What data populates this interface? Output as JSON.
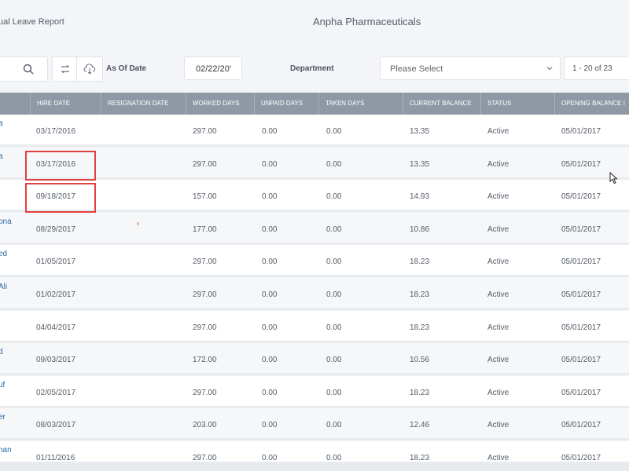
{
  "header": {
    "report_title": "ual Leave Report",
    "company": "Anpha Pharmaceuticals"
  },
  "toolbar": {
    "as_of_label": "As Of Date",
    "date_value": "02/22/20'",
    "department_label": "Department",
    "department_placeholder": "Please Select",
    "pager_text": "1 - 20 of 23"
  },
  "columns": [
    "Hire Date",
    "Resignation Date",
    "Worked Days",
    "Unpaid Days",
    "Taken Days",
    "Current Balance",
    "Status",
    "Opening Balance I"
  ],
  "rows": [
    {
      "name": "a",
      "hire": "03/17/2016",
      "resign": "",
      "worked": "297.00",
      "unpaid": "0.00",
      "taken": "0.00",
      "balance": "13.35",
      "status": "Active",
      "opening": "05/01/2017"
    },
    {
      "name": "a",
      "hire": "03/17/2016",
      "resign": "",
      "worked": "297.00",
      "unpaid": "0.00",
      "taken": "0.00",
      "balance": "13.35",
      "status": "Active",
      "opening": "05/01/2017"
    },
    {
      "name": "",
      "hire": "09/18/2017",
      "resign": "",
      "worked": "157.00",
      "unpaid": "0.00",
      "taken": "0.00",
      "balance": "14.93",
      "status": "Active",
      "opening": "05/01/2017"
    },
    {
      "name": "ona",
      "hire": "08/29/2017",
      "resign": "",
      "worked": "177.00",
      "unpaid": "0.00",
      "taken": "0.00",
      "balance": "10.86",
      "status": "Active",
      "opening": "05/01/2017"
    },
    {
      "name": "ed",
      "hire": "01/05/2017",
      "resign": "",
      "worked": "297.00",
      "unpaid": "0.00",
      "taken": "0.00",
      "balance": "18.23",
      "status": "Active",
      "opening": "05/01/2017"
    },
    {
      "name": "Ali",
      "hire": "01/02/2017",
      "resign": "",
      "worked": "297.00",
      "unpaid": "0.00",
      "taken": "0.00",
      "balance": "18.23",
      "status": "Active",
      "opening": "05/01/2017"
    },
    {
      "name": "",
      "hire": "04/04/2017",
      "resign": "",
      "worked": "297.00",
      "unpaid": "0.00",
      "taken": "0.00",
      "balance": "18.23",
      "status": "Active",
      "opening": "05/01/2017"
    },
    {
      "name": "d",
      "hire": "09/03/2017",
      "resign": "",
      "worked": "172.00",
      "unpaid": "0.00",
      "taken": "0.00",
      "balance": "10.56",
      "status": "Active",
      "opening": "05/01/2017"
    },
    {
      "name": "uf",
      "hire": "02/05/2017",
      "resign": "",
      "worked": "297.00",
      "unpaid": "0.00",
      "taken": "0.00",
      "balance": "18.23",
      "status": "Active",
      "opening": "05/01/2017"
    },
    {
      "name": "er",
      "hire": "08/03/2017",
      "resign": "",
      "worked": "203.00",
      "unpaid": "0.00",
      "taken": "0.00",
      "balance": "12.46",
      "status": "Active",
      "opening": "05/01/2017"
    },
    {
      "name": "nan",
      "hire": "01/11/2016",
      "resign": "",
      "worked": "297.00",
      "unpaid": "0.00",
      "taken": "0.00",
      "balance": "18.23",
      "status": "Active",
      "opening": "05/01/2017"
    }
  ],
  "colors": {
    "header_bg": "#8f99a5",
    "link": "#2b6aa3",
    "highlight": "#e0403f"
  }
}
